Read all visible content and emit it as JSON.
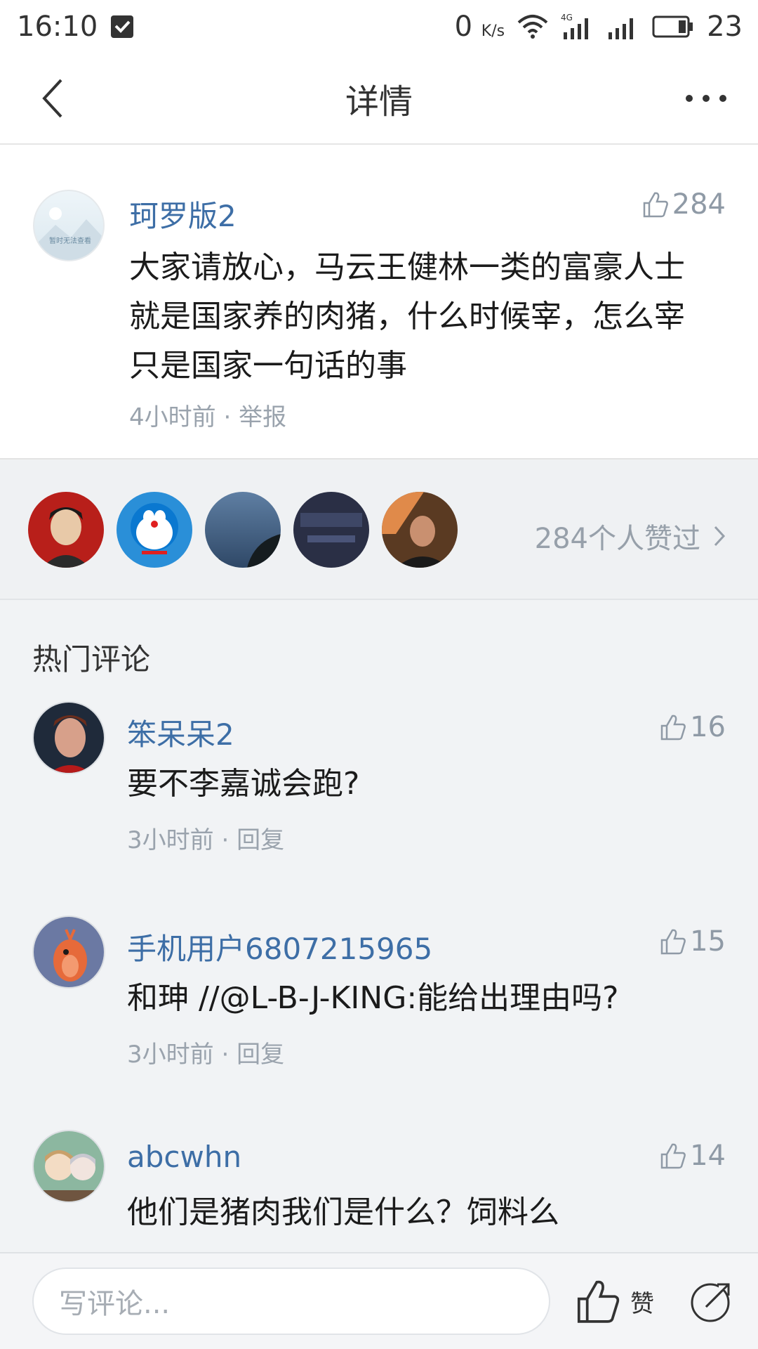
{
  "status_bar": {
    "time": "16:10",
    "network_speed": "0",
    "network_unit": "K/s",
    "network_type": "4G",
    "battery": "23",
    "icons": [
      "notification-icon",
      "wifi-icon",
      "signal-4g-icon",
      "signal-icon",
      "battery-icon"
    ]
  },
  "nav": {
    "title": "详情",
    "back_icon": "chevron-left-icon",
    "more_icon": "more-dots-icon"
  },
  "post": {
    "author": "珂罗版2",
    "like_count": "284",
    "text": "大家请放心，马云王健林一类的富豪人士就是国家养的肉猪，什么时候宰，怎么宰只是国家一句话的事",
    "time": "4小时前",
    "separator": " · ",
    "report_label": "举报",
    "avatar_placeholder": "暂时无法查看"
  },
  "likers": {
    "count": 5,
    "summary": "284个人赞过"
  },
  "hot_comments": {
    "title": "热门评论",
    "items": [
      {
        "author": "笨呆呆2",
        "likes": "16",
        "text": "要不李嘉诚会跑?",
        "time": "3小时前",
        "separator": " · ",
        "reply_label": "回复"
      },
      {
        "author": "手机用户6807215965",
        "likes": "15",
        "text": "和珅 //@L-B-J-KING:能给出理由吗?",
        "time": "3小时前",
        "separator": " · ",
        "reply_label": "回复"
      },
      {
        "author": "abcwhn",
        "likes": "14",
        "text": "他们是猪肉我们是什么？饲料么",
        "time": "",
        "separator": "",
        "reply_label": ""
      }
    ]
  },
  "bottom_bar": {
    "input_placeholder": "写评论...",
    "like_label": "赞"
  },
  "colors": {
    "accent_name": "#3d6ea6",
    "meta_gray": "#9aa3ad",
    "background": "#f1f3f5"
  }
}
